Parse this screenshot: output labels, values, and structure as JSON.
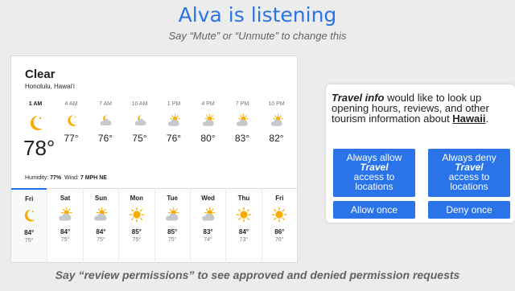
{
  "assistant": {
    "title": "Alva is listening",
    "subtitle": "Say “Mute” or “Unmute” to change this"
  },
  "weather": {
    "condition": "Clear",
    "location": "Honolulu, Hawaiʻi",
    "current_temp": "78°",
    "humidity_label": "Humidity:",
    "humidity": "77%",
    "wind_label": "Wind:",
    "wind": "7 MPH NE",
    "hourly": [
      {
        "time": "1 AM",
        "temp": "",
        "icon": "moon-icon",
        "now": true
      },
      {
        "time": "4 AM",
        "temp": "77°",
        "icon": "moon-icon"
      },
      {
        "time": "7 AM",
        "temp": "76°",
        "icon": "partly-cloudy-night-icon"
      },
      {
        "time": "10 AM",
        "temp": "75°",
        "icon": "partly-cloudy-night-icon"
      },
      {
        "time": "1 PM",
        "temp": "76°",
        "icon": "partly-cloudy-icon"
      },
      {
        "time": "4 PM",
        "temp": "80°",
        "icon": "partly-cloudy-icon"
      },
      {
        "time": "7 PM",
        "temp": "83°",
        "icon": "partly-cloudy-icon"
      },
      {
        "time": "10 PM",
        "temp": "82°",
        "icon": "partly-cloudy-icon"
      }
    ],
    "daily": [
      {
        "day": "Fri",
        "hi": "84°",
        "lo": "75°",
        "icon": "moon-icon"
      },
      {
        "day": "Sat",
        "hi": "84°",
        "lo": "75°",
        "icon": "partly-cloudy-icon"
      },
      {
        "day": "Sun",
        "hi": "84°",
        "lo": "75°",
        "icon": "partly-cloudy-icon"
      },
      {
        "day": "Mon",
        "hi": "85°",
        "lo": "75°",
        "icon": "sun-icon"
      },
      {
        "day": "Tue",
        "hi": "85°",
        "lo": "75°",
        "icon": "partly-cloudy-icon"
      },
      {
        "day": "Wed",
        "hi": "83°",
        "lo": "74°",
        "icon": "partly-cloudy-icon"
      },
      {
        "day": "Thu",
        "hi": "84°",
        "lo": "73°",
        "icon": "sun-icon"
      },
      {
        "day": "Fri",
        "hi": "86°",
        "lo": "76°",
        "icon": "sun-icon"
      }
    ]
  },
  "permission": {
    "app_name": "Travel info",
    "message": " would like to look up opening hours, reviews, and other tourism information about ",
    "place": "Hawaii",
    "period": ".",
    "allow_always_pre": "Always allow",
    "allow_always_app": "Travel",
    "allow_always_post": "access to locations",
    "deny_always_pre": "Always deny",
    "deny_always_app": "Travel",
    "deny_always_post": "access to locations",
    "allow_once": "Allow once",
    "deny_once": "Deny once"
  },
  "footer": {
    "pre": "Say ",
    "highlight": "“review permissions”",
    "post": " to see approved and denied permission requests"
  },
  "colors": {
    "accent": "#2a73e8",
    "sun": "#f9ab00",
    "cloud": "#c5c9ce",
    "moon": "#f9ab00"
  }
}
